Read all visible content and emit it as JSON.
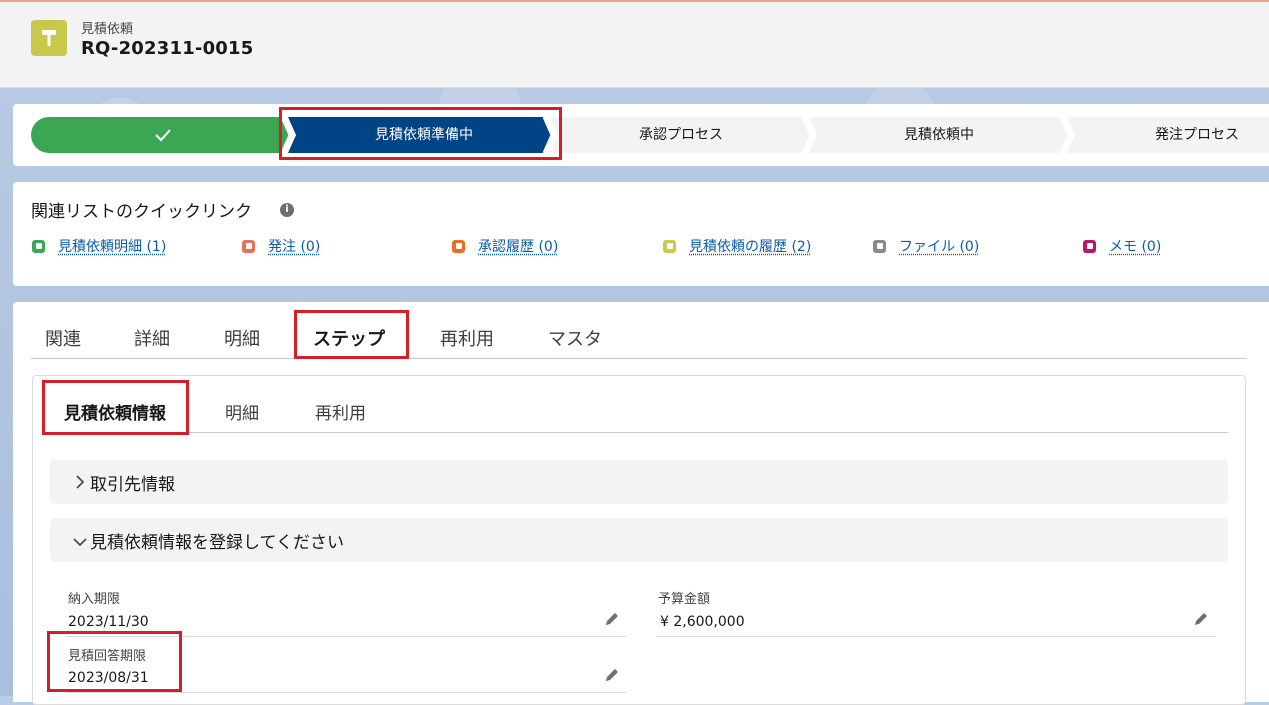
{
  "header": {
    "object_type": "見積依頼",
    "record_name": "RQ-202311-0015",
    "icon": "hammer-icon",
    "icon_color": "#c8c84a"
  },
  "path": {
    "steps": [
      {
        "label": "",
        "state": "complete",
        "icon": "check-icon"
      },
      {
        "label": "見積依頼準備中",
        "state": "current"
      },
      {
        "label": "承認プロセス",
        "state": "incomplete"
      },
      {
        "label": "見積依頼中",
        "state": "incomplete"
      },
      {
        "label": "発注プロセス",
        "state": "incomplete"
      }
    ],
    "colors": {
      "complete": "#3ba755",
      "current": "#014486",
      "incomplete": "#f3f3f3"
    }
  },
  "quick_links": {
    "title": "関連リストのクイックリンク",
    "info_icon": "info-icon",
    "items": [
      {
        "label": "見積依頼明細 (1)",
        "icon_color": "#3ba755",
        "icon": "list-icon"
      },
      {
        "label": "発注 (0)",
        "icon_color": "#e3735e",
        "icon": "pencil-icon"
      },
      {
        "label": "承認履歴 (0)",
        "icon_color": "#e86d2b",
        "icon": "approval-icon"
      },
      {
        "label": "見積依頼の履歴 (2)",
        "icon_color": "#c8c84a",
        "icon": "hammer-icon"
      },
      {
        "label": "ファイル (0)",
        "icon_color": "#8a8a8a",
        "icon": "file-icon"
      },
      {
        "label": "メモ (0)",
        "icon_color": "#b5176a",
        "icon": "note-icon"
      }
    ]
  },
  "tabs": {
    "items": [
      "関連",
      "詳細",
      "明細",
      "ステップ",
      "再利用",
      "マスタ"
    ],
    "active": "ステップ"
  },
  "subtabs": {
    "items": [
      "見積依頼情報",
      "明細",
      "再利用"
    ],
    "active": "見積依頼情報"
  },
  "sections": [
    {
      "label": "取引先情報",
      "expanded": false
    },
    {
      "label": "見積依頼情報を登録してください",
      "expanded": true
    }
  ],
  "fields": {
    "delivery_deadline": {
      "label": "納入期限",
      "value": "2023/11/30"
    },
    "budget": {
      "label": "予算金額",
      "value": "¥ 2,600,000"
    },
    "quote_deadline": {
      "label": "見積回答期限",
      "value": "2023/08/31"
    }
  }
}
